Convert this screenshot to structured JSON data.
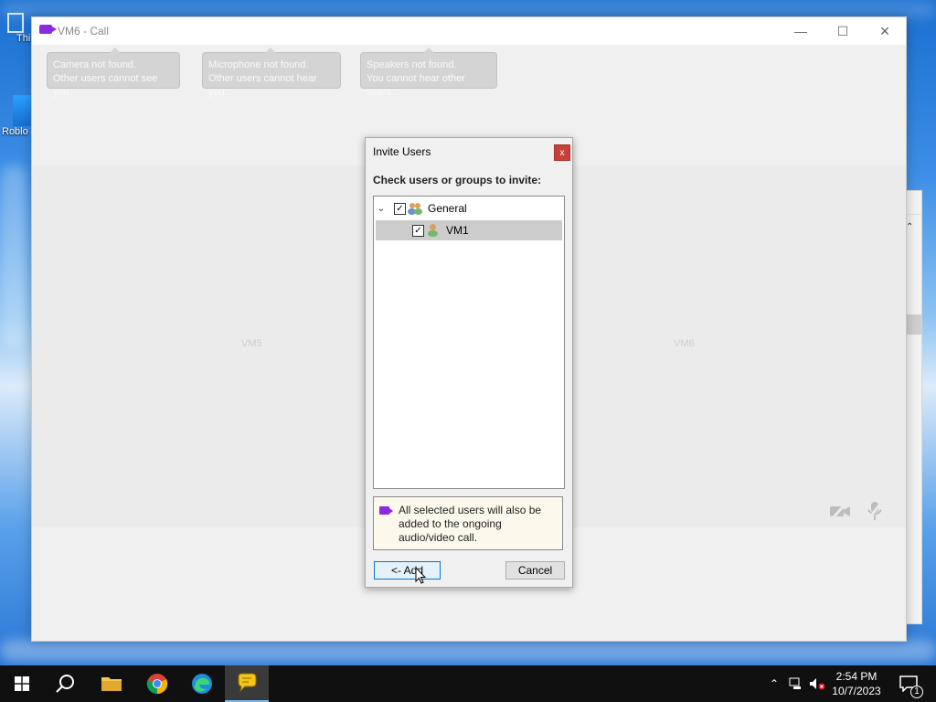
{
  "desktop": {
    "icons": [
      {
        "label": "Thi"
      },
      {
        "label": "Roblo"
      }
    ]
  },
  "call_window": {
    "title": "VM6 - Call",
    "controls": {
      "minimize": "—",
      "maximize": "☐",
      "close": "✕"
    },
    "notices": [
      {
        "line1": "Camera not found.",
        "line2": "Other users cannot see you."
      },
      {
        "line1": "Microphone not found.",
        "line2": "Other users cannot hear you."
      },
      {
        "line1": "Speakers not found.",
        "line2": "You cannot hear other users."
      }
    ],
    "panes": {
      "left": "VM5",
      "right": "VM6"
    }
  },
  "dialog": {
    "title": "Invite Users",
    "close": "x",
    "prompt": "Check users or groups to invite:",
    "tree": [
      {
        "label": "General",
        "checked": true,
        "type": "group"
      },
      {
        "label": "VM1",
        "checked": true,
        "type": "user",
        "selected": true
      }
    ],
    "info": "All selected users will also be added to the ongoing audio/video call.",
    "add_label": "<- Add",
    "cancel_label": "Cancel"
  },
  "taskbar": {
    "clock_time": "2:54 PM",
    "clock_date": "10/7/2023",
    "notification_count": "1"
  },
  "colors": {
    "accent": "#8a2be2",
    "close_red": "#c9403a",
    "taskbar": "#101010"
  }
}
